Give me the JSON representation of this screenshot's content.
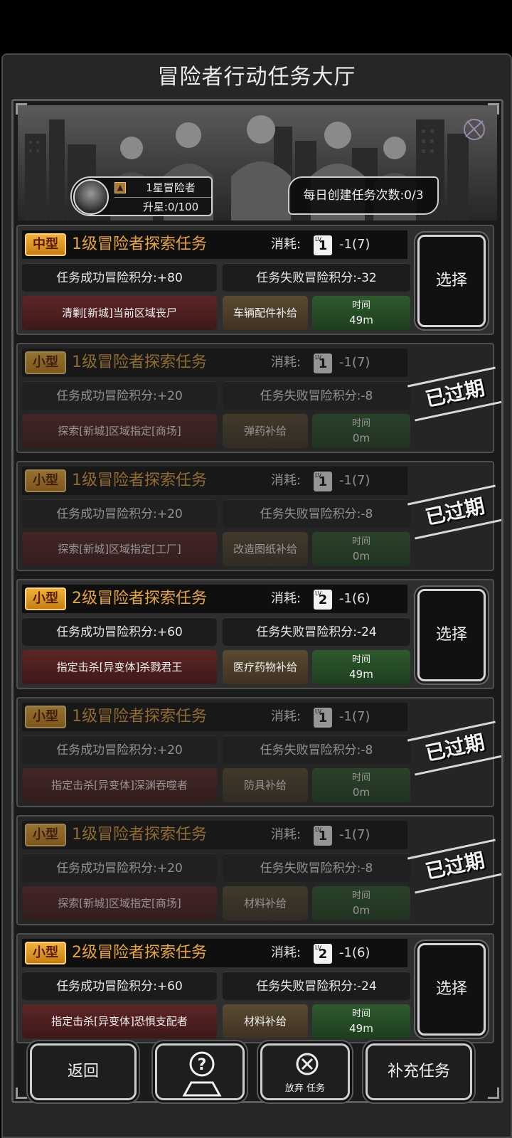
{
  "title": "冒险者行动任务大厅",
  "profile": {
    "rank": "1星冒险者",
    "upgrade": "升星:0/100"
  },
  "daily_quota": "每日创建任务次数:0/3",
  "cost_label": "消耗:",
  "time_label": "时间",
  "select_label": "选择",
  "expired_label": "已过期",
  "tasks": [
    {
      "size": "中型",
      "name": "1级冒险者探索任务",
      "lv": "1",
      "cost": "-1(7)",
      "success": "任务成功冒险积分:+80",
      "fail": "任务失败冒险积分:-32",
      "target": "清剿[新城]当前区域丧尸",
      "reward": "车辆配件补给",
      "time": "49m",
      "expired": false
    },
    {
      "size": "小型",
      "name": "1级冒险者探索任务",
      "lv": "1",
      "cost": "-1(7)",
      "success": "任务成功冒险积分:+20",
      "fail": "任务失败冒险积分:-8",
      "target": "探索[新城]区域指定[商场]",
      "reward": "弹药补给",
      "time": "0m",
      "expired": true
    },
    {
      "size": "小型",
      "name": "1级冒险者探索任务",
      "lv": "1",
      "cost": "-1(7)",
      "success": "任务成功冒险积分:+20",
      "fail": "任务失败冒险积分:-8",
      "target": "探索[新城]区域指定[工厂]",
      "reward": "改造图纸补给",
      "time": "0m",
      "expired": true
    },
    {
      "size": "小型",
      "name": "2级冒险者探索任务",
      "lv": "2",
      "cost": "-1(6)",
      "success": "任务成功冒险积分:+60",
      "fail": "任务失败冒险积分:-24",
      "target": "指定击杀[异变体]杀戮君王",
      "reward": "医疗药物补给",
      "time": "49m",
      "expired": false
    },
    {
      "size": "小型",
      "name": "1级冒险者探索任务",
      "lv": "1",
      "cost": "-1(7)",
      "success": "任务成功冒险积分:+20",
      "fail": "任务失败冒险积分:-8",
      "target": "指定击杀[异变体]深渊吞噬者",
      "reward": "防具补给",
      "time": "0m",
      "expired": true
    },
    {
      "size": "小型",
      "name": "1级冒险者探索任务",
      "lv": "1",
      "cost": "-1(7)",
      "success": "任务成功冒险积分:+20",
      "fail": "任务失败冒险积分:-8",
      "target": "探索[新城]区域指定[商场]",
      "reward": "材料补给",
      "time": "0m",
      "expired": true
    },
    {
      "size": "小型",
      "name": "2级冒险者探索任务",
      "lv": "2",
      "cost": "-1(6)",
      "success": "任务成功冒险积分:+60",
      "fail": "任务失败冒险积分:-24",
      "target": "指定击杀[异变体]恐惧支配者",
      "reward": "材料补给",
      "time": "49m",
      "expired": false
    }
  ],
  "bottom": {
    "back": "返回",
    "help_icon": "question-map-icon",
    "abandon_icon": "close-circle-icon",
    "abandon_label": "放弃 任务",
    "refill": "补充任务"
  }
}
